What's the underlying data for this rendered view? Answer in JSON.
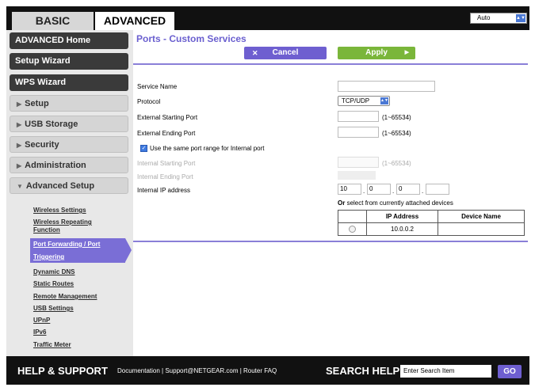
{
  "tabs": {
    "basic": "BASIC",
    "advanced": "ADVANCED"
  },
  "language": {
    "selected": "Auto"
  },
  "sidebar": {
    "main_items": [
      {
        "label": "ADVANCED Home"
      },
      {
        "label": "Setup Wizard"
      },
      {
        "label": "WPS Wizard"
      }
    ],
    "sections": [
      {
        "label": "Setup"
      },
      {
        "label": "USB Storage"
      },
      {
        "label": "Security"
      },
      {
        "label": "Administration"
      },
      {
        "label": "Advanced Setup"
      }
    ],
    "sub_items": [
      {
        "label": "Wireless Settings"
      },
      {
        "label": "Wireless Repeating"
      },
      {
        "label": "Function"
      },
      {
        "label": "Port Forwarding / Port"
      },
      {
        "label": "Triggering"
      },
      {
        "label": "Dynamic DNS"
      },
      {
        "label": "Static Routes"
      },
      {
        "label": "Remote Management"
      },
      {
        "label": "USB Settings"
      },
      {
        "label": "UPnP"
      },
      {
        "label": "IPv6"
      },
      {
        "label": "Traffic Meter"
      }
    ]
  },
  "main": {
    "title": "Ports - Custom Services",
    "cancel_label": "Cancel",
    "apply_label": "Apply",
    "form": {
      "service_name_label": "Service Name",
      "protocol_label": "Protocol",
      "protocol_value": "TCP/UDP",
      "ext_start_label": "External Starting Port",
      "ext_end_label": "External Ending Port",
      "range_hint": "(1~65534)",
      "same_range_label": "Use the same port range for Internal port",
      "int_start_label": "Internal Starting Port",
      "int_end_label": "Internal Ending Port",
      "int_ip_label": "Internal IP address",
      "ip_octets": [
        "10",
        "0",
        "0",
        ""
      ]
    },
    "devices": {
      "intro_bold": "Or",
      "intro_rest": " select from currently attached devices",
      "col_ip": "IP Address",
      "col_name": "Device Name",
      "rows": [
        {
          "ip": "10.0.0.2",
          "name": ""
        }
      ]
    }
  },
  "footer": {
    "help": "HELP & SUPPORT",
    "links": "Documentation | Support@NETGEAR.com | Router FAQ",
    "search_help": "SEARCH HELP",
    "search_placeholder": "Enter Search Item",
    "go": "GO"
  }
}
